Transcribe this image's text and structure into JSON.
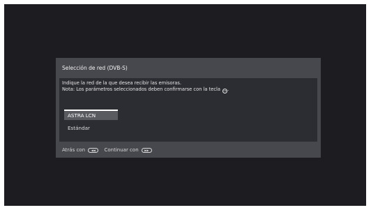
{
  "dialog": {
    "title": "Selección de red (DVB-S)",
    "instruction_line1": "Indique la red de la que desea recibir las emisoras.",
    "instruction_line2": "Nota: Los parámetros seleccionados deben confirmarse con la tecla",
    "ok_icon": "OK",
    "options": [
      {
        "label": "ASTRA LCN",
        "selected": true
      },
      {
        "label": "Estándar",
        "selected": false
      }
    ],
    "footer": {
      "back_label": "Atrás con",
      "back_icon": "◀◀",
      "continue_label": "Continuar con",
      "continue_icon": "▶▶"
    }
  },
  "colors": {
    "background": "#1d1d21",
    "dialog": "#47484d",
    "dialog_body": "#2c2d32",
    "selected": "#5a5b60"
  }
}
